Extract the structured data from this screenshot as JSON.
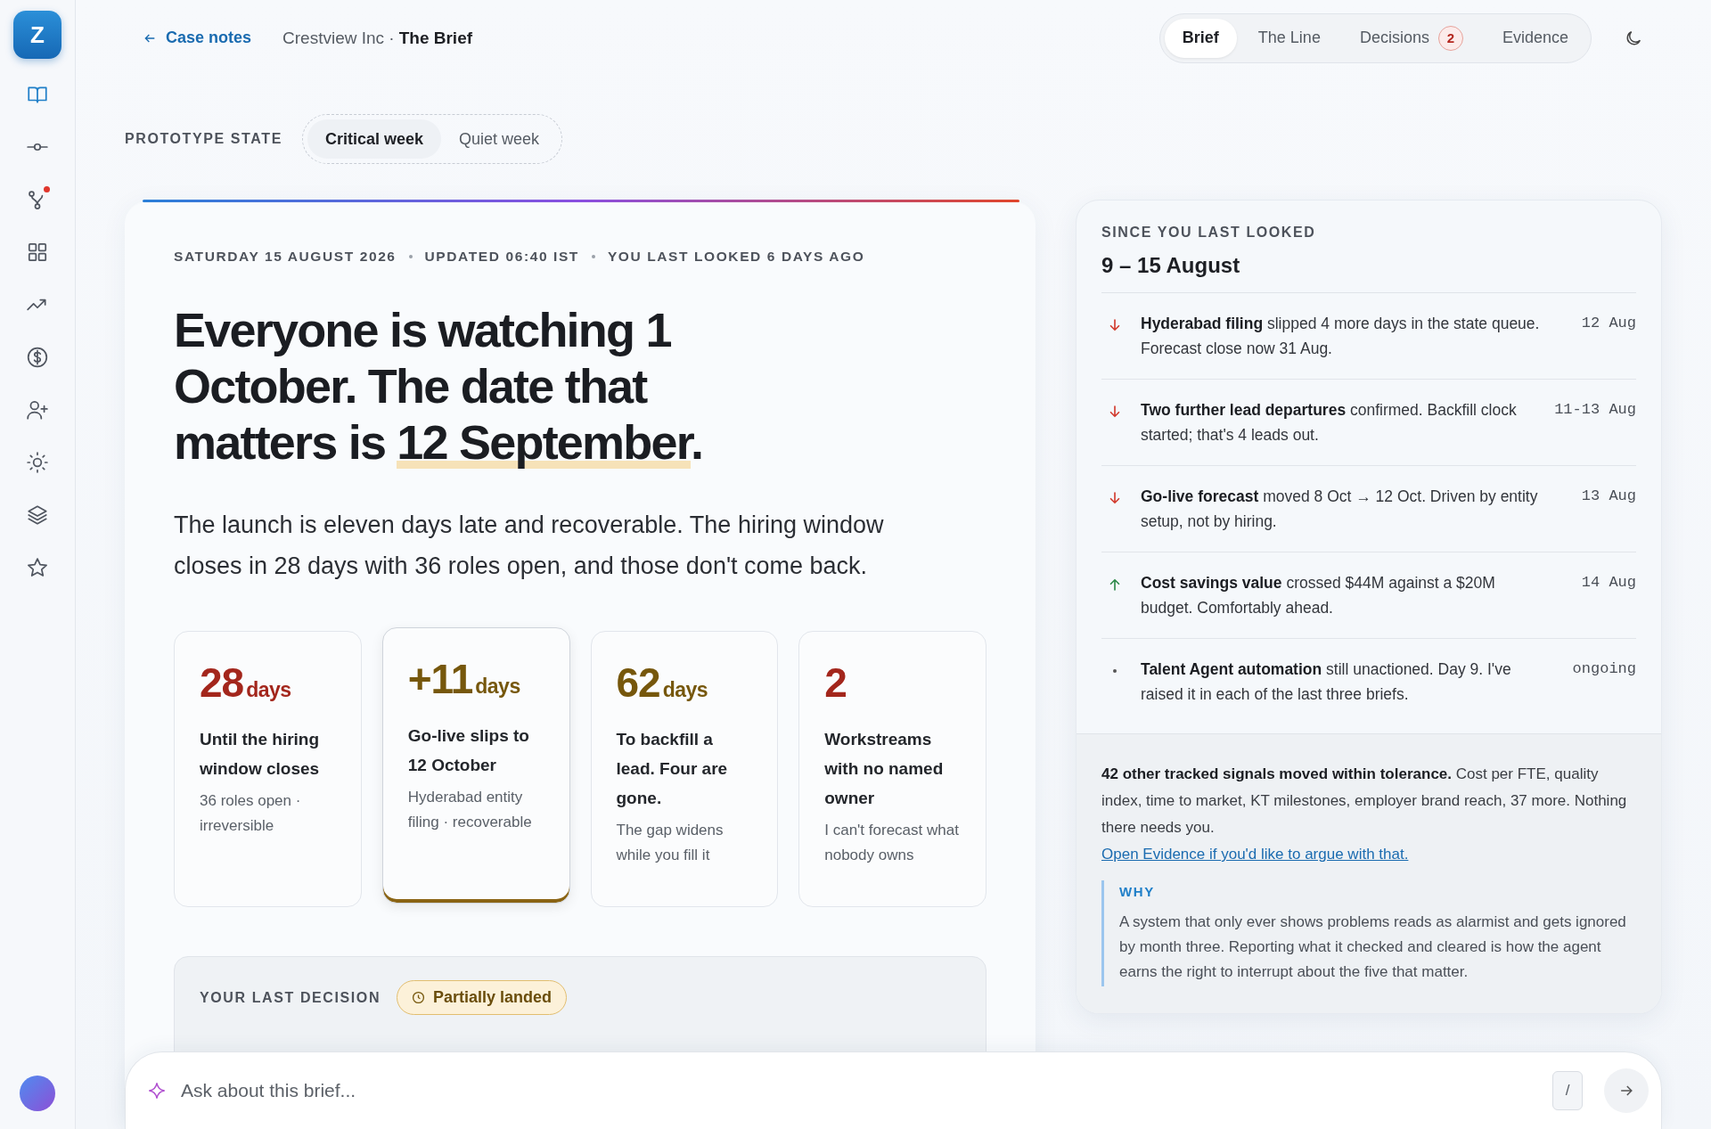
{
  "sidebar": {
    "logo": "Z",
    "items": [
      {
        "kind": "book",
        "selected": true,
        "alert": false
      },
      {
        "kind": "commit",
        "selected": false,
        "alert": false
      },
      {
        "kind": "branch",
        "selected": false,
        "alert": true
      },
      {
        "kind": "grid",
        "selected": false,
        "alert": false
      },
      {
        "kind": "trend",
        "selected": false,
        "alert": false
      },
      {
        "kind": "dollar",
        "selected": false,
        "alert": false
      },
      {
        "kind": "user-plus",
        "selected": false,
        "alert": false
      },
      {
        "kind": "sun",
        "selected": false,
        "alert": false
      },
      {
        "kind": "layers",
        "selected": false,
        "alert": false
      },
      {
        "kind": "star",
        "selected": false,
        "alert": false
      }
    ]
  },
  "topbar": {
    "back_link": "Case notes",
    "breadcrumb_org": "Crestview Inc ·",
    "breadcrumb_page": "The Brief",
    "tabs": [
      {
        "label": "Brief",
        "selected": true
      },
      {
        "label": "The Line",
        "selected": false
      },
      {
        "label": "Decisions",
        "selected": false,
        "badge": "2"
      },
      {
        "label": "Evidence",
        "selected": false
      }
    ]
  },
  "prototype_state": {
    "label": "PROTOTYPE STATE",
    "options": [
      {
        "label": "Critical week",
        "selected": true
      },
      {
        "label": "Quiet week",
        "selected": false
      }
    ]
  },
  "brief": {
    "meta": [
      "SATURDAY 15 AUGUST 2026",
      "UPDATED 06:40 IST",
      "YOU LAST LOOKED 6 DAYS AGO"
    ],
    "headline": [
      {
        "text": "Everyone is watching 1 October. The date that matters is ",
        "highlight": false
      },
      {
        "text": "12 September",
        "highlight": true
      },
      {
        "text": ".",
        "highlight": false
      }
    ],
    "summary": "The launch is eleven days late and recoverable. The hiring window closes in 28 days with 36 roles open, and those don't come back.",
    "stats": [
      {
        "value": "28",
        "unit": "days",
        "color": "#a3261c",
        "title": "Until the hiring window closes",
        "note": "36 roles open · irreversible",
        "selected": false
      },
      {
        "value": "+11",
        "unit": "days",
        "color": "#76570c",
        "title": "Go-live slips to 12 October",
        "note": "Hyderabad entity filing · recoverable",
        "selected": true
      },
      {
        "value": "62",
        "unit": "days",
        "color": "#76570c",
        "title": "To backfill a lead. Four are gone.",
        "note": "The gap widens while you fill it",
        "selected": false
      },
      {
        "value": "2",
        "color": "#a3261c",
        "title": "Workstreams with no named owner",
        "note": "I can't forecast what nobody owns",
        "selected": false
      }
    ],
    "last_decision": {
      "label": "YOUR LAST DECISION",
      "status": "Partially landed"
    }
  },
  "since": {
    "label": "SINCE YOU LAST LOOKED",
    "range": "9 – 15 August",
    "items": [
      {
        "kind": "down",
        "text": "**Hyderabad filing** slipped 4 more days in the state queue. Forecast close now 31 Aug.",
        "date": "12 Aug"
      },
      {
        "kind": "down",
        "text": "**Two further lead departures** confirmed. Backfill clock started; that's 4 leads out.",
        "date": "11-13 Aug"
      },
      {
        "kind": "down",
        "text": "**Go-live forecast** moved 8 Oct → 12 Oct. Driven by entity setup, not by hiring.",
        "date": "13 Aug"
      },
      {
        "kind": "up",
        "text": "**Cost savings value** crossed $44M against a $20M budget. Comfortably ahead.",
        "date": "14 Aug"
      },
      {
        "kind": "flat",
        "text": "**Talent Agent automation** still unactioned. Day 9. I've raised it in each of the last three briefs.",
        "date": "ongoing"
      }
    ],
    "tolerance": "**42 other tracked signals moved within tolerance.** Cost per FTE, quality index, time to market, KT milestones, employer brand reach, 37 more. Nothing there needs you.",
    "evidence_link": "Open Evidence if you'd like to argue with that.",
    "why_label": "WHY",
    "why_text": "A system that only ever shows problems reads as alarmist and gets ignored by month three. Reporting what it checked and cleared is how the agent earns the right to interrupt about the five that matter."
  },
  "ask": {
    "placeholder": "Ask about this brief...",
    "shortcut": "/"
  }
}
